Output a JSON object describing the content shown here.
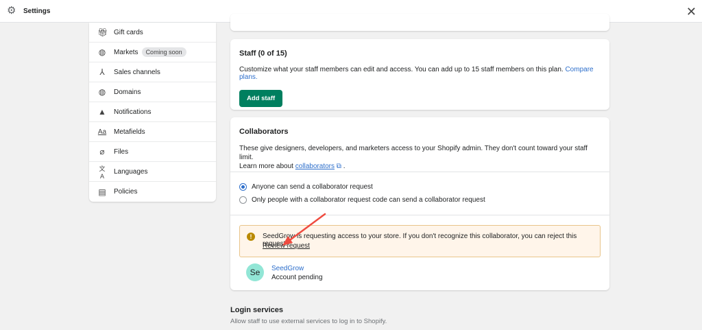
{
  "header": {
    "title": "Settings"
  },
  "sidebar": {
    "items": [
      {
        "label": "Gift cards",
        "icon": "gift-icon"
      },
      {
        "label": "Markets",
        "icon": "globe-icon",
        "badge": "Coming soon"
      },
      {
        "label": "Sales channels",
        "icon": "channels-icon"
      },
      {
        "label": "Domains",
        "icon": "domain-globe-icon"
      },
      {
        "label": "Notifications",
        "icon": "bell-icon"
      },
      {
        "label": "Metafields",
        "icon": "metafields-icon"
      },
      {
        "label": "Files",
        "icon": "paperclip-icon"
      },
      {
        "label": "Languages",
        "icon": "translate-icon"
      },
      {
        "label": "Policies",
        "icon": "document-icon"
      }
    ]
  },
  "staff": {
    "title": "Staff (0 of 15)",
    "description": "Customize what your staff members can edit and access. You can add up to 15 staff members on this plan.",
    "compare_link": "Compare plans.",
    "add_button": "Add staff"
  },
  "collaborators": {
    "title": "Collaborators",
    "description": "These give designers, developers, and marketers access to your Shopify admin. They don't count toward your staff limit.",
    "learn_more": "Learn more about",
    "learn_link": "collaborators",
    "options": [
      {
        "label": "Anyone can send a collaborator request",
        "selected": true
      },
      {
        "label": "Only people with a collaborator request code can send a collaborator request",
        "selected": false
      }
    ],
    "banner": {
      "text": "SeedGrow is requesting access to your store. If you don't recognize this collaborator, you can reject this request.",
      "action": "Review request"
    },
    "request": {
      "initials": "Se",
      "name": "SeedGrow",
      "status": "Account pending"
    }
  },
  "login_services": {
    "title": "Login services",
    "description": "Allow staff to use external services to log in to Shopify."
  },
  "colors": {
    "primary": "#007f5f",
    "link": "#2c6ecb",
    "annotation_arrow": "#ef4b3f"
  }
}
